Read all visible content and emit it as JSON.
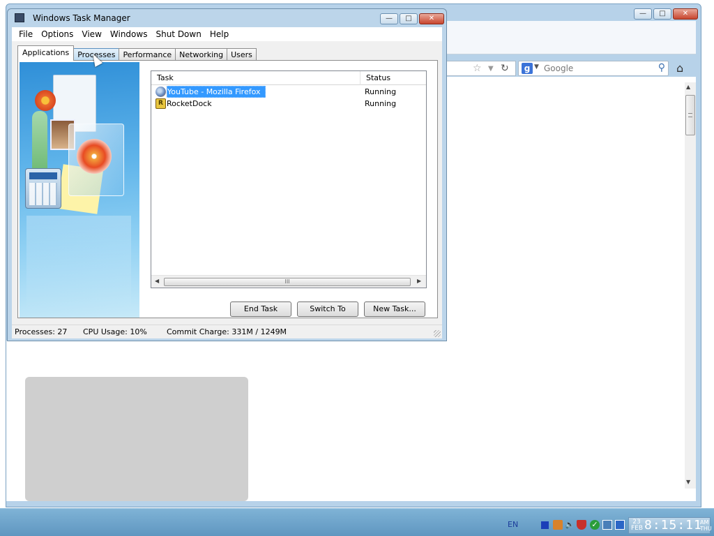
{
  "browser": {
    "search_placeholder": "Google",
    "search_engine_icon": "g"
  },
  "task_manager": {
    "title": "Windows Task Manager",
    "menu": [
      "File",
      "Options",
      "View",
      "Windows",
      "Shut Down",
      "Help"
    ],
    "tabs": [
      "Applications",
      "Processes",
      "Performance",
      "Networking",
      "Users"
    ],
    "active_tab": "Applications",
    "columns": {
      "task": "Task",
      "status": "Status"
    },
    "rows": [
      {
        "name": "YouTube - Mozilla Firefox",
        "status": "Running",
        "icon": "firefox-icon",
        "selected": true
      },
      {
        "name": "RocketDock",
        "status": "Running",
        "icon": "rocketdock-icon",
        "selected": false
      }
    ],
    "scroll_grip": "III",
    "buttons": {
      "end_task": "End Task",
      "switch_to": "Switch To",
      "new_task": "New Task..."
    },
    "status": {
      "processes": "Processes: 27",
      "cpu": "CPU Usage: 10%",
      "commit": "Commit Charge: 331M / 1249M"
    }
  },
  "taskbar": {
    "language": "EN",
    "date_day": "23",
    "date_month": "FEB",
    "time": "8:15:11",
    "ampm": "AM",
    "weekday": "THU"
  },
  "colors": {
    "selection": "#3399ff",
    "window_frame": "#bcd5ea",
    "taskbar": "#6fa5cc"
  }
}
